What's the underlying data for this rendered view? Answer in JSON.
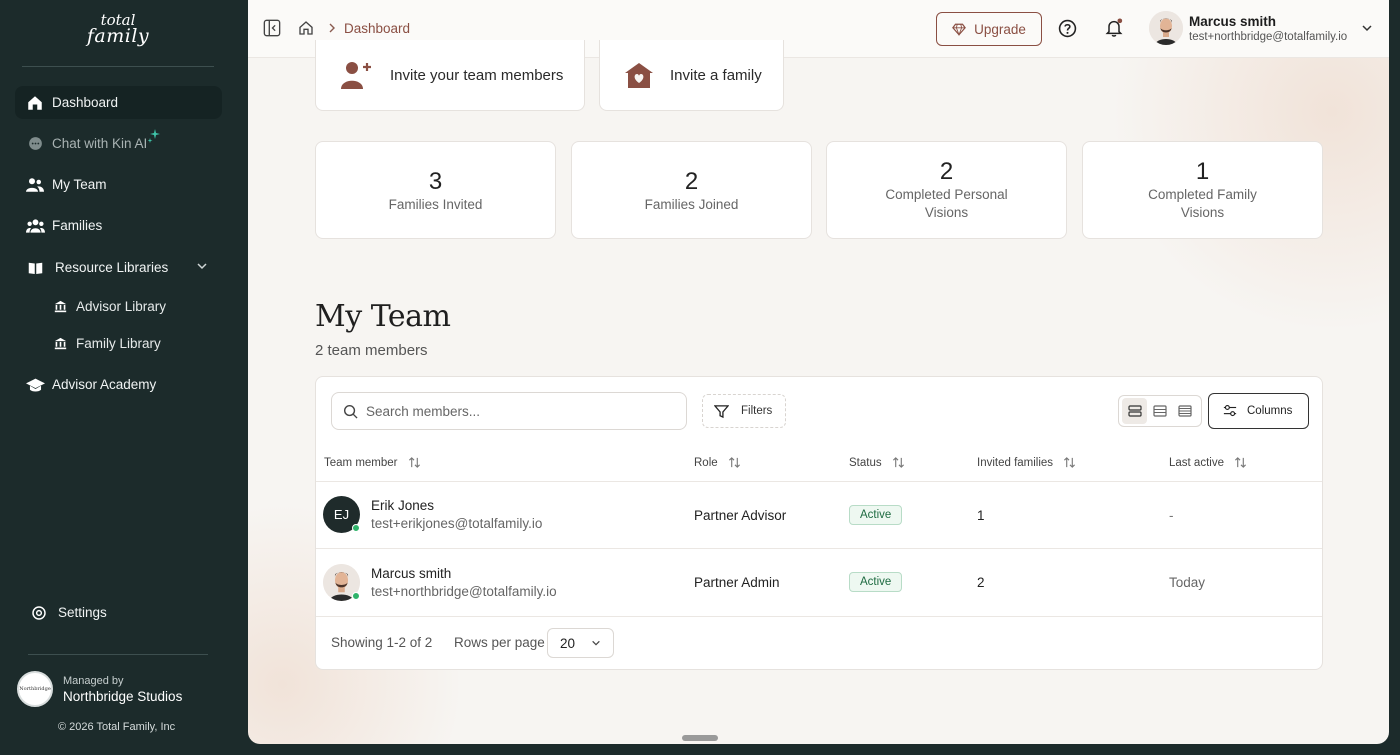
{
  "brand": {
    "logo_line1": "total",
    "logo_line2": "family"
  },
  "sidebar": {
    "items": [
      {
        "label": "Dashboard",
        "icon": "home-icon"
      },
      {
        "label": "Chat with Kin AI",
        "icon": "chat-icon"
      },
      {
        "label": "My Team",
        "icon": "team-icon"
      },
      {
        "label": "Families",
        "icon": "families-icon"
      },
      {
        "label": "Resource Libraries",
        "icon": "book-icon"
      },
      {
        "label": "Advisor Library",
        "icon": "library-icon"
      },
      {
        "label": "Family Library",
        "icon": "library-icon"
      },
      {
        "label": "Advisor Academy",
        "icon": "graduation-cap-icon"
      }
    ],
    "settings_label": "Settings",
    "managed_by_label": "Managed by",
    "managed_by_org": "Northbridge Studios",
    "badge_text": "Northbridge",
    "copyright": "© 2026 Total Family, Inc"
  },
  "topbar": {
    "breadcrumb": "Dashboard",
    "upgrade_label": "Upgrade",
    "user_name": "Marcus smith",
    "user_email": "test+northbridge@totalfamily.io"
  },
  "quick_actions": [
    {
      "label": "Invite your team members"
    },
    {
      "label": "Invite a family"
    }
  ],
  "stats": [
    {
      "value": "3",
      "label": "Families Invited"
    },
    {
      "value": "2",
      "label": "Families Joined"
    },
    {
      "value": "2",
      "label": "Completed Personal Visions"
    },
    {
      "value": "1",
      "label": "Completed Family Visions"
    }
  ],
  "team": {
    "title": "My Team",
    "subtitle": "2 team members",
    "search_placeholder": "Search members...",
    "filters_label": "Filters",
    "columns_label": "Columns",
    "headers": [
      "Team member",
      "Role",
      "Status",
      "Invited families",
      "Last active"
    ],
    "rows": [
      {
        "initials": "EJ",
        "name": "Erik Jones",
        "email": "test+erikjones@totalfamily.io",
        "role": "Partner Advisor",
        "status": "Active",
        "invited": "1",
        "last_active": "-"
      },
      {
        "initials": "",
        "name": "Marcus smith",
        "email": "test+northbridge@totalfamily.io",
        "role": "Partner Admin",
        "status": "Active",
        "invited": "2",
        "last_active": "Today"
      }
    ],
    "showing": "Showing 1-2 of 2",
    "rows_per_page_label": "Rows per page",
    "rows_per_page_value": "20"
  },
  "colors": {
    "sidebar_bg": "#1c2b2b",
    "accent": "#8a4f43",
    "active_green": "#1e6b41",
    "online_dot": "#2fb36a"
  }
}
